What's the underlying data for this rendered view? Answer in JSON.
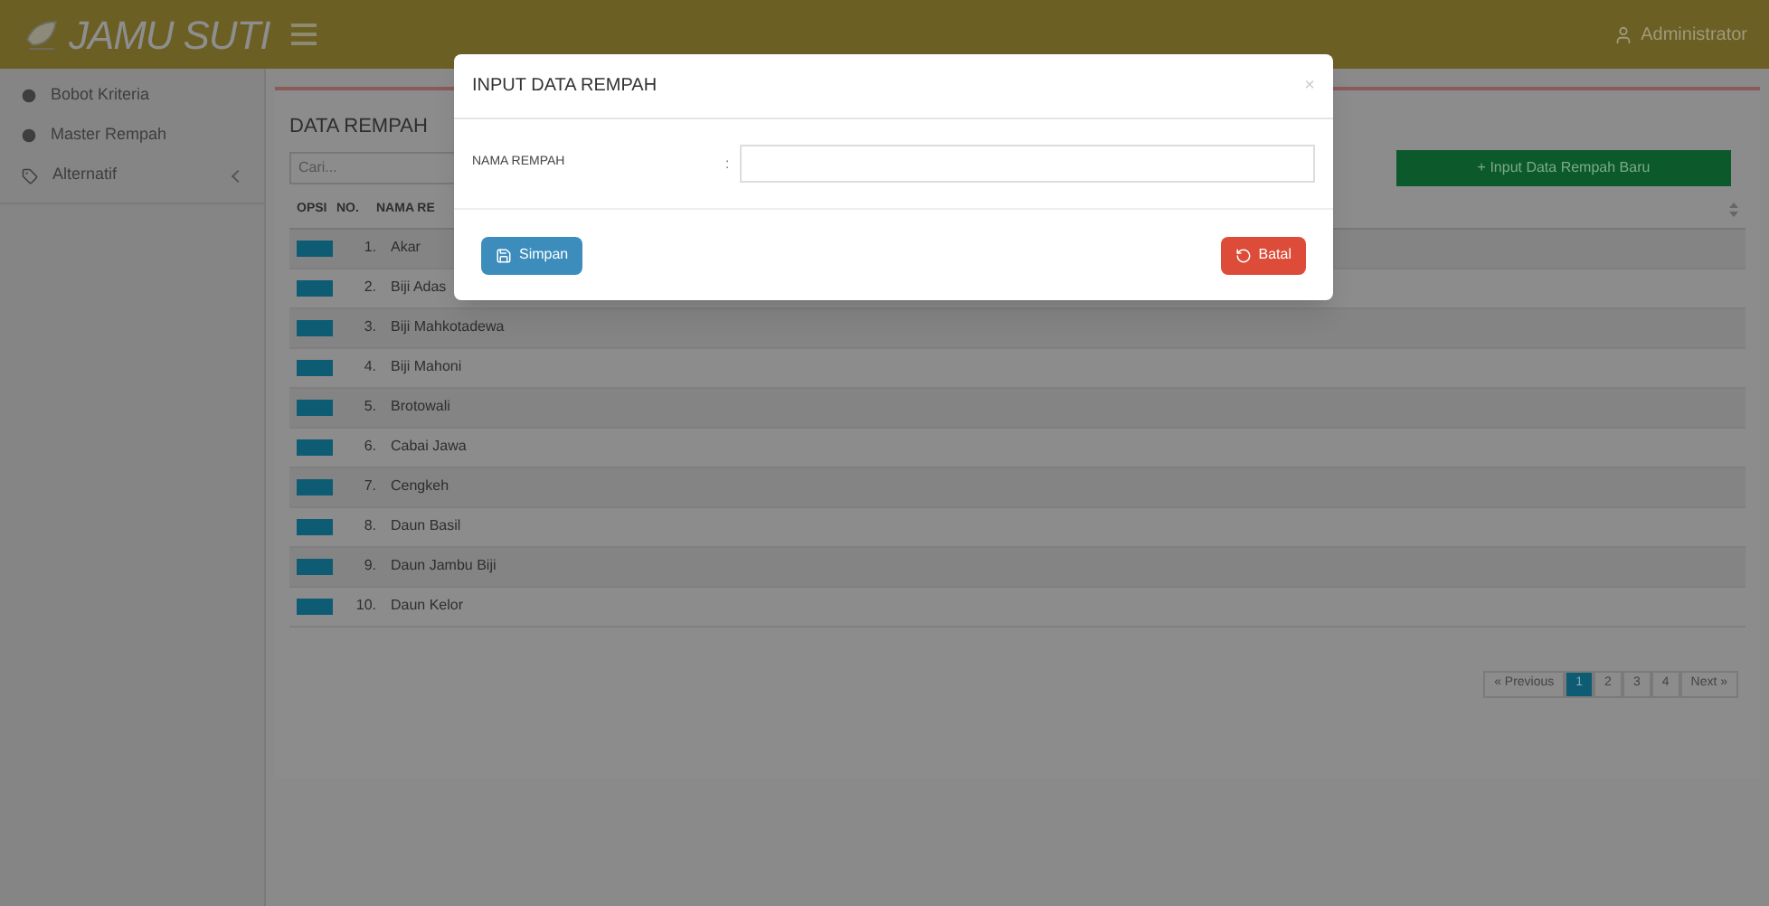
{
  "header": {
    "logo": "JAMU SUTI",
    "user": "Administrator"
  },
  "sidebar": {
    "items": [
      {
        "label": "Bobot Kriteria",
        "kind": "link"
      },
      {
        "label": "Master Rempah",
        "kind": "link"
      },
      {
        "label": "Alternatif",
        "kind": "group"
      }
    ]
  },
  "content": {
    "title": "DATA REMPAH",
    "search": {
      "placeholder": "Cari..."
    },
    "add_button": "+ Input Data Rempah Baru",
    "table": {
      "columns": [
        "OPSI",
        "NO.",
        "NAMA RE"
      ],
      "rows": [
        {
          "no": "1.",
          "name": "Akar"
        },
        {
          "no": "2.",
          "name": "Biji Adas"
        },
        {
          "no": "3.",
          "name": "Biji Mahkotadewa"
        },
        {
          "no": "4.",
          "name": "Biji Mahoni"
        },
        {
          "no": "5.",
          "name": "Brotowali"
        },
        {
          "no": "6.",
          "name": "Cabai Jawa"
        },
        {
          "no": "7.",
          "name": "Cengkeh"
        },
        {
          "no": "8.",
          "name": "Daun Basil"
        },
        {
          "no": "9.",
          "name": "Daun Jambu Biji"
        },
        {
          "no": "10.",
          "name": "Daun Kelor"
        }
      ]
    },
    "pagination": [
      {
        "label": "« Previous",
        "selected": false
      },
      {
        "label": "1",
        "selected": true
      },
      {
        "label": "2",
        "selected": false
      },
      {
        "label": "3",
        "selected": false
      },
      {
        "label": "4",
        "selected": false
      },
      {
        "label": "Next »",
        "selected": false
      }
    ]
  },
  "modal": {
    "title": "INPUT DATA REMPAH",
    "close": "×",
    "field_label": "NAMA REMPAH",
    "separator": ":",
    "save_button": "Simpan",
    "back_button": "Batal"
  }
}
